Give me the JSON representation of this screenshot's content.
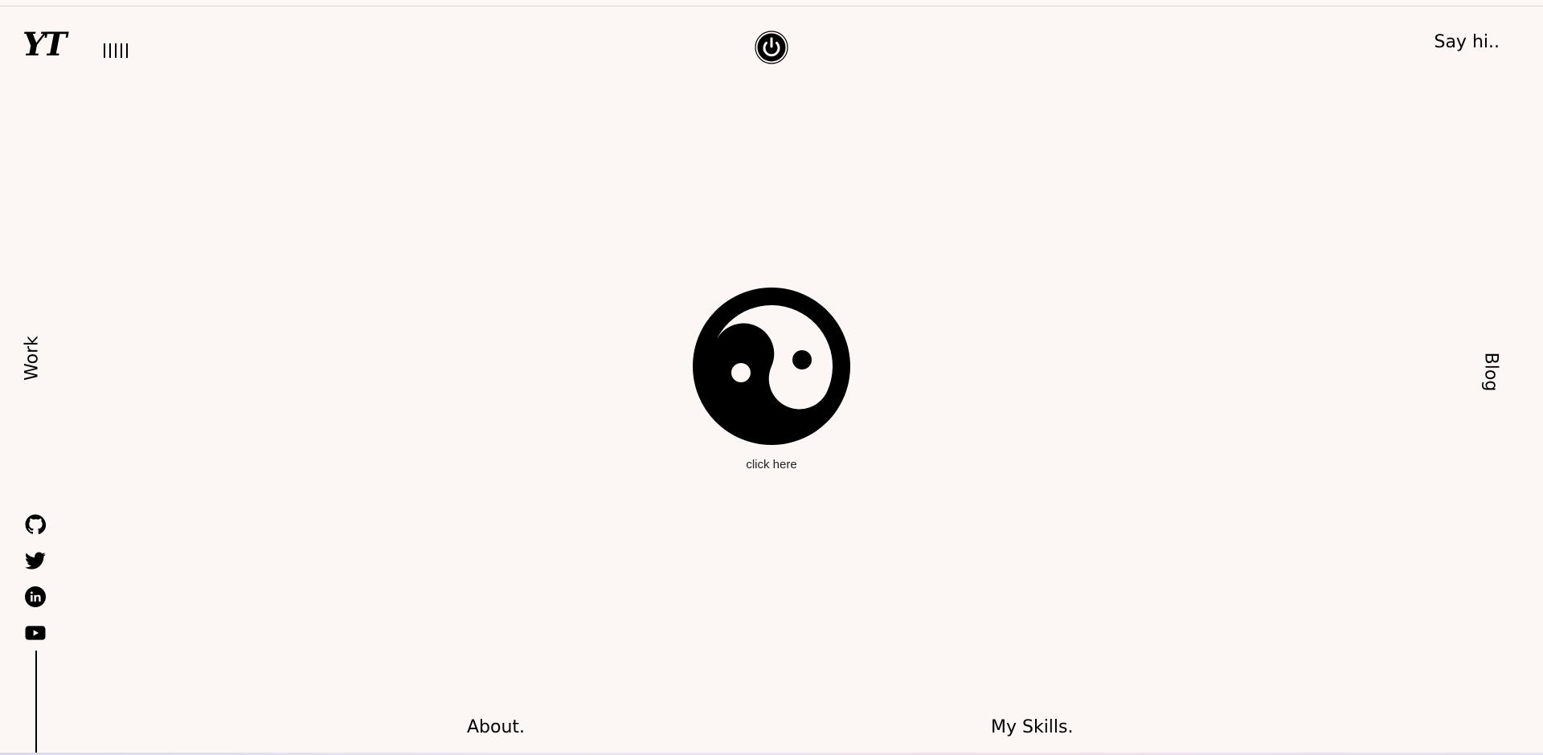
{
  "header": {
    "logo_text": "YT",
    "say_hi_label": "Say hi..",
    "power_icon": "power-icon",
    "sound_icon": "sound-bars-icon"
  },
  "nav": {
    "work_label": "Work",
    "blog_label": "Blog",
    "about_label": "About.",
    "skills_label": "My Skills."
  },
  "center": {
    "icon": "yin-yang-icon",
    "caption": "click here"
  },
  "socials": {
    "icons": [
      "github-icon",
      "twitter-icon",
      "linkedin-icon",
      "youtube-icon"
    ]
  },
  "colors": {
    "background": "#FCF6F4",
    "foreground": "#000000"
  }
}
